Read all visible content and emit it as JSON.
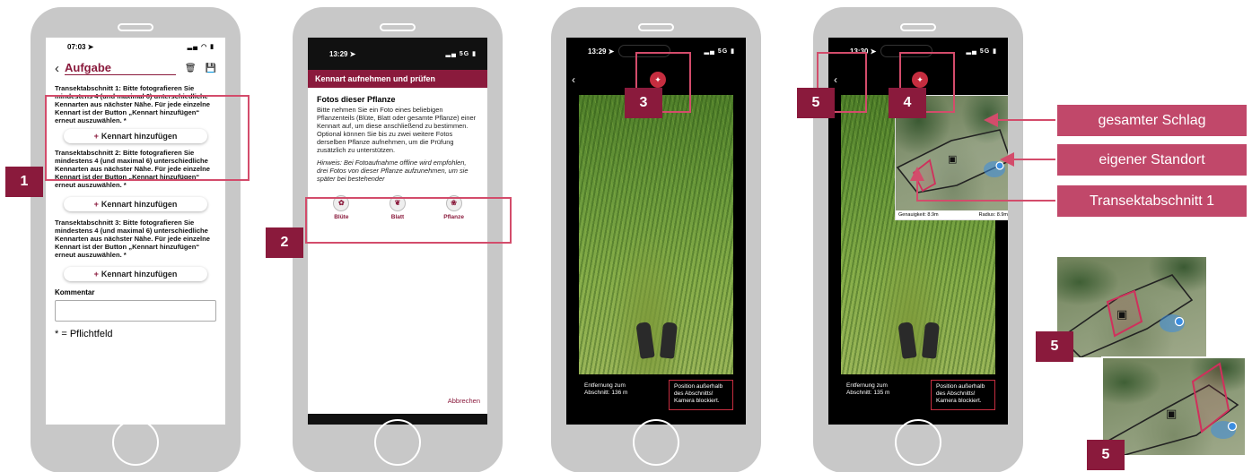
{
  "phone1": {
    "time": "07:03 ➤",
    "header_title": "Aufgabe",
    "tasks": [
      {
        "text": "Transektabschnitt 1: Bitte fotografieren Sie mindestens 4 (und maximal 6) unterschiedliche Kennarten aus nächster Nähe. Für jede einzelne Kennart ist der Button „Kennart hinzufügen“ erneut auszuwählen. *",
        "button": "Kennart hinzufügen"
      },
      {
        "text": "Transektabschnitt 2: Bitte fotografieren Sie mindestens 4 (und maximal 6) unterschiedliche Kennarten aus nächster Nähe. Für jede einzelne Kennart ist der Button „Kennart hinzufügen“ erneut auszuwählen. *",
        "button": "Kennart hinzufügen"
      },
      {
        "text": "Transektabschnitt 3: Bitte fotografieren Sie mindestens 4 (und maximal 6) unterschiedliche Kennarten aus nächster Nähe. Für jede einzelne Kennart ist der Button „Kennart hinzufügen“ erneut auszuwählen. *",
        "button": "Kennart hinzufügen"
      }
    ],
    "comment_label": "Kommentar",
    "footnote": "* = Pflichtfeld"
  },
  "phone2": {
    "time": "13:29 ➤",
    "network": "5G",
    "banner": "Kennart aufnehmen und prüfen",
    "heading": "Fotos dieser Pflanze",
    "description": "Bitte nehmen Sie ein Foto eines beliebigen Pflanzenteils (Blüte, Blatt oder gesamte Pflanze) einer Kennart auf, um diese anschließend zu bestimmen. Optional können Sie bis zu zwei weitere Fotos derselben Pflanze aufnehmen, um die Prüfung zusätzlich zu unterstützen.",
    "hint": "Hinweis: Bei Fotoaufnahme offline wird empfohlen, drei Fotos von dieser Pflanze aufzunehmen, um sie später bei bestehender",
    "photo_options": [
      "Blüte",
      "Blatt",
      "Pflanze"
    ],
    "cancel": "Abbrechen"
  },
  "phone3": {
    "time": "13:29 ➤",
    "network": "5G",
    "distance": "Entfernung zum Abschnitt: 136 m",
    "warning": "Position außerhalb des Abschnitts! Kamera blockiert."
  },
  "phone4": {
    "time": "13:30 ➤",
    "network": "5G",
    "accuracy": "Genauigkeit: 8.9m",
    "radius": "Radius: 8.9m",
    "distance": "Entfernung zum Abschnitt: 135 m",
    "warning": "Position außerhalb des Abschnitts! Kamera blockiert."
  },
  "badges": [
    "1",
    "2",
    "3",
    "4",
    "5",
    "5",
    "5"
  ],
  "labels": [
    "gesamter Schlag",
    "eigener Standort",
    "Transektabschnitt 1"
  ],
  "colors": {
    "accent": "#8a1a3c",
    "callout": "#d34c6b",
    "label_bg": "#c1486a",
    "location": "#3b8de0"
  }
}
